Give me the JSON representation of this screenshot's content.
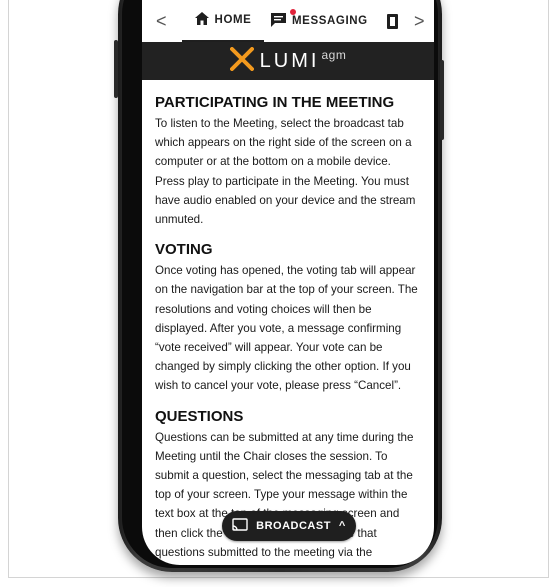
{
  "nav": {
    "prev": "<",
    "next": ">",
    "tabs": [
      {
        "label": "HOME"
      },
      {
        "label": "MESSAGING"
      }
    ]
  },
  "brand": {
    "name": "LUMI",
    "suffix": "agm"
  },
  "sections": [
    {
      "heading": "PARTICIPATING IN THE MEETING",
      "body": "To listen to the Meeting, select the broadcast tab which appears on the right side of the screen on a computer or at the bottom on a mobile device. Press play to participate in the Meeting. You must have audio enabled on your device and the stream unmuted."
    },
    {
      "heading": "VOTING",
      "body": "Once voting has opened, the voting tab will appear on the navigation bar at the top of your screen. The resolutions and voting choices will then be displayed. After you vote, a message confirming “vote received” will appear. Your vote can be changed by simply clicking the other option. If you wish to cancel your vote, please press “Cancel”."
    },
    {
      "heading": "QUESTIONS",
      "body": "Questions can be submitted at any time during the Meeting until the Chair closes the session. To submit a question, select the messaging tab at the top of your screen. Type your message within the text box at the top of the messaging screen and then click the send button. Please note that questions submitted to the meeting via the"
    }
  ],
  "broadcast": {
    "label": "BROADCAST",
    "chevron": "^"
  },
  "colors": {
    "header_bg": "#222222",
    "logo_orange": "#f39a1e",
    "badge": "#e0233a"
  }
}
